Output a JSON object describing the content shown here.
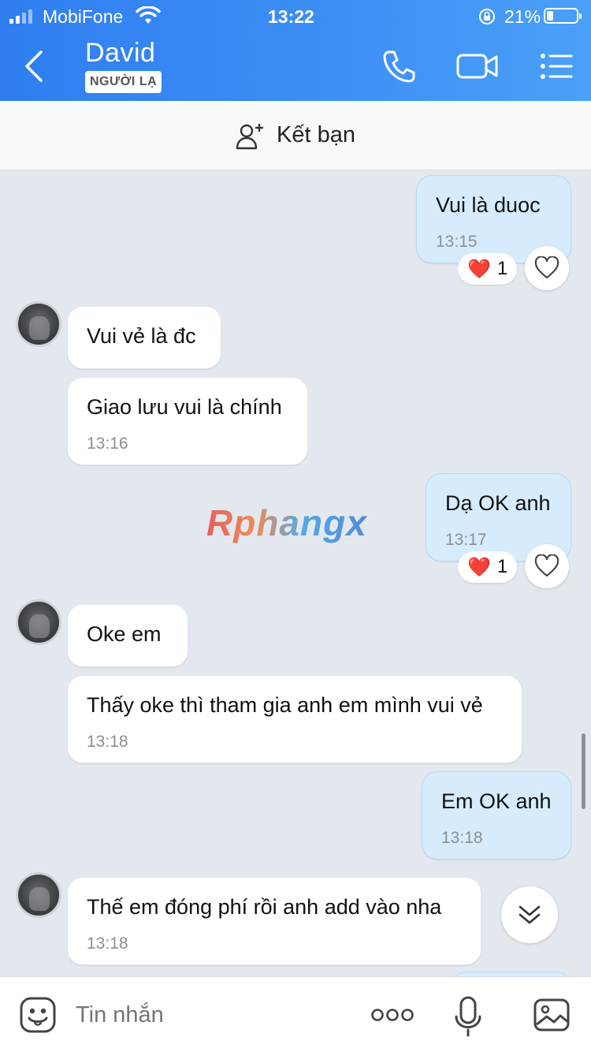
{
  "status": {
    "carrier": "MobiFone",
    "time": "13:22",
    "battery": "21%",
    "battery_level": 0.21
  },
  "header": {
    "title": "David",
    "badge": "NGƯỜI LẠ",
    "icons": [
      "back-icon",
      "phone-icon",
      "video-call-icon",
      "menu-icon"
    ]
  },
  "friend_bar": {
    "label": "Kết bạn",
    "icon": "add-person-icon"
  },
  "messages": [
    {
      "side": "out",
      "text": "Vui là duoc",
      "time": "13:15",
      "reaction": {
        "emoji": "❤️",
        "count": "1"
      }
    },
    {
      "side": "in",
      "text": "Vui vẻ là đc",
      "time": ""
    },
    {
      "side": "in",
      "text": "Giao lưu vui là chính",
      "time": "13:16"
    },
    {
      "side": "out",
      "text": "Dạ OK anh",
      "time": "13:17",
      "reaction": {
        "emoji": "❤️",
        "count": "1"
      }
    },
    {
      "side": "in",
      "text": "Oke em",
      "time": ""
    },
    {
      "side": "in",
      "text": "Thấy oke thì tham gia anh em mình vui vẻ",
      "time": "13:18"
    },
    {
      "side": "out",
      "text": "Em OK anh",
      "time": "13:18"
    },
    {
      "side": "in",
      "text": "Thế em đóng phí rồi anh add vào nha",
      "time": "13:18"
    }
  ],
  "watermark": "Rphangx",
  "composer": {
    "placeholder": "Tin nhắn",
    "icons": [
      "sticker-icon",
      "more-icon",
      "microphone-icon",
      "image-icon"
    ]
  },
  "colors": {
    "header_start": "#2f7ef0",
    "header_end": "#4aa0f7",
    "outgoing_bubble": "#d6ecfc",
    "incoming_bubble": "#ffffff",
    "chat_background": "#e3e8ef"
  }
}
